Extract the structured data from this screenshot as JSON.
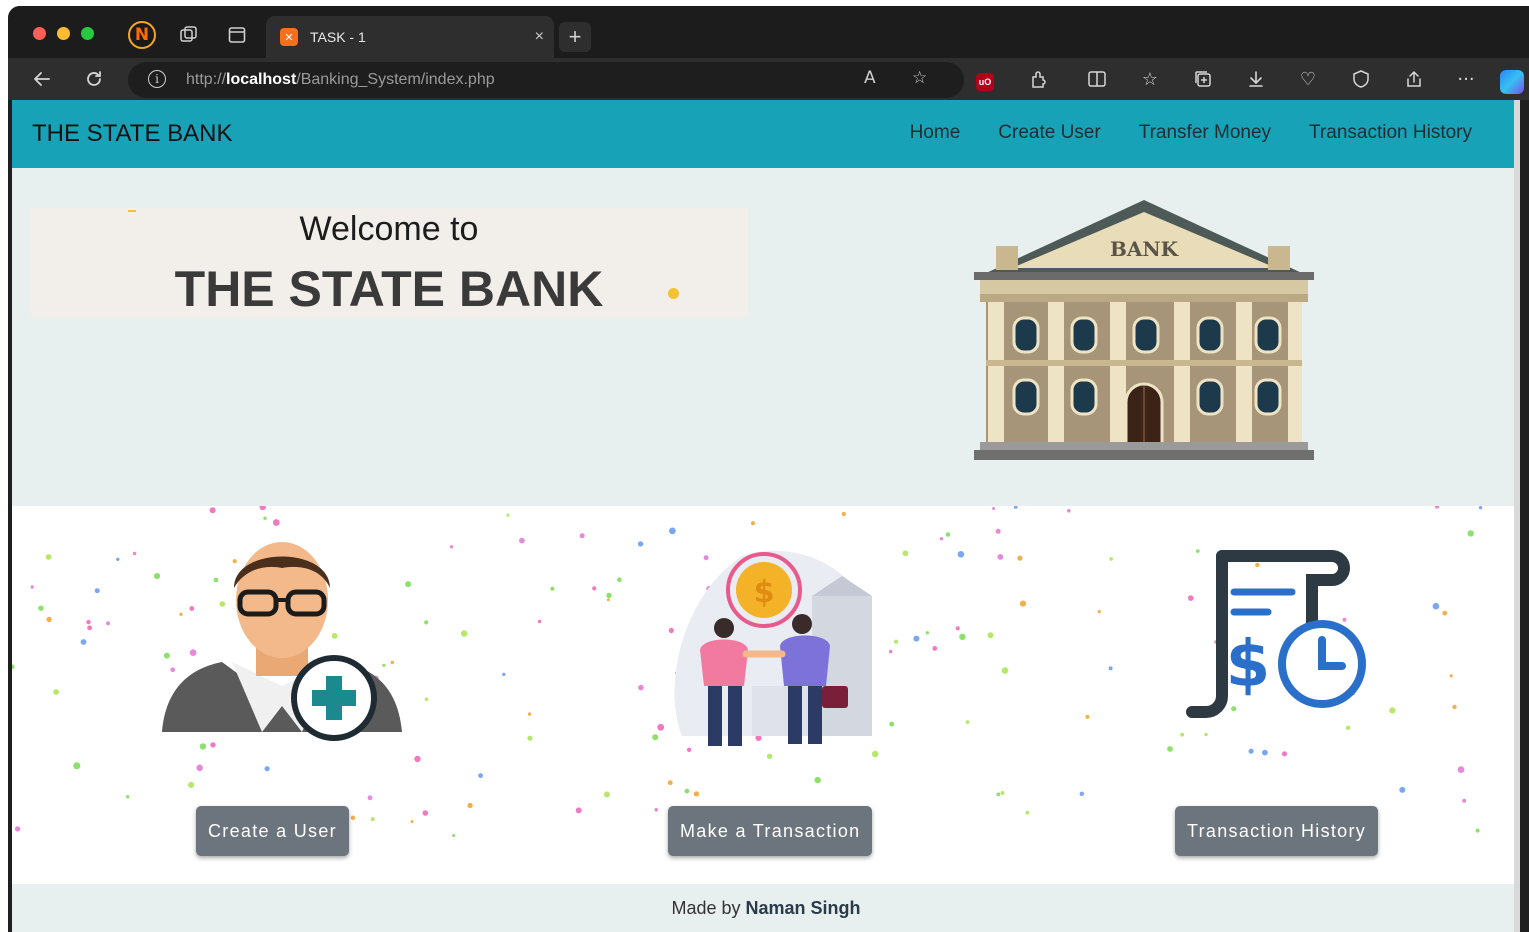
{
  "browser": {
    "tab_title": "TASK - 1",
    "tab_close": "×",
    "new_tab": "+",
    "url_prefix": "http://",
    "url_host": "localhost",
    "url_path": "/Banking_System/index.php",
    "icons": [
      "back-icon",
      "refresh-icon",
      "site-info-icon",
      "read-aloud-icon",
      "favorite-star-icon",
      "ublock-icon",
      "extensions-icon",
      "split-screen-icon",
      "favorites-icon",
      "collections-icon",
      "download-icon",
      "performance-icon",
      "browser-essentials-icon",
      "share-icon",
      "more-icon",
      "copilot-icon"
    ],
    "read_aloud_label": "A",
    "ublock_label": "uO",
    "more_label": "···"
  },
  "navbar": {
    "brand": "THE STATE BANK",
    "links": [
      "Home",
      "Create User",
      "Transfer Money",
      "Transaction History"
    ],
    "color": "#17a2b8"
  },
  "hero": {
    "welcome": "Welcome to",
    "bank_name": "THE STATE BANK",
    "building_sign": "BANK"
  },
  "cards": [
    {
      "button": "Create a User",
      "icon": "add-user-icon"
    },
    {
      "button": "Make a Transaction",
      "icon": "transaction-icon"
    },
    {
      "button": "Transaction History",
      "icon": "transaction-history-icon"
    }
  ],
  "footer": {
    "prefix": "Made by",
    "author": "Naman Singh"
  }
}
